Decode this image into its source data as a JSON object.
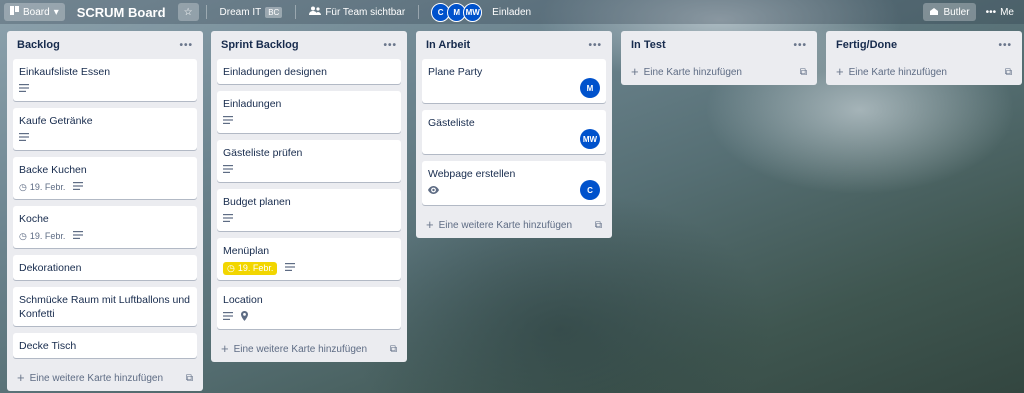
{
  "header": {
    "board_switcher": "Board",
    "board_title": "SCRUM Board",
    "team_name": "Dream IT",
    "team_badge": "BC",
    "visibility": "Für Team sichtbar",
    "members": [
      "C",
      "M",
      "MW"
    ],
    "invite": "Einladen",
    "butler": "Butler",
    "menu": "Me"
  },
  "lists": [
    {
      "title": "Backlog",
      "cards": [
        {
          "title": "Einkaufsliste Essen",
          "description": true
        },
        {
          "title": "Kaufe Getränke",
          "description": true
        },
        {
          "title": "Backe Kuchen",
          "due": "19. Febr.",
          "description": true
        },
        {
          "title": "Koche",
          "due": "19. Febr.",
          "description": true
        },
        {
          "title": "Dekorationen"
        },
        {
          "title": "Schmücke Raum mit Luftballons und Konfetti"
        },
        {
          "title": "Decke Tisch"
        }
      ],
      "add_label": "Eine weitere Karte hinzufügen"
    },
    {
      "title": "Sprint Backlog",
      "cards": [
        {
          "title": "Einladungen designen"
        },
        {
          "title": "Einladungen",
          "description": true
        },
        {
          "title": "Gästeliste prüfen",
          "description": true
        },
        {
          "title": "Budget planen",
          "description": true
        },
        {
          "title": "Menüplan",
          "due": "19. Febr.",
          "due_color": "#f2d600",
          "description": true
        },
        {
          "title": "Location",
          "description": true,
          "location": true
        }
      ],
      "add_label": "Eine weitere Karte hinzufügen"
    },
    {
      "title": "In Arbeit",
      "cards": [
        {
          "title": "Plane Party",
          "member": "M"
        },
        {
          "title": "Gästeliste",
          "member": "MW"
        },
        {
          "title": "Webpage erstellen",
          "member": "C",
          "watching": true
        }
      ],
      "add_label": "Eine weitere Karte hinzufügen"
    },
    {
      "title": "In Test",
      "cards": [],
      "add_label": "Eine Karte hinzufügen"
    },
    {
      "title": "Fertig/Done",
      "cards": [],
      "add_label": "Eine Karte hinzufügen"
    }
  ],
  "colors": {
    "member_avatar": "#0052cc",
    "due_soon": "#f2d600",
    "list_bg": "#ebecf0"
  }
}
